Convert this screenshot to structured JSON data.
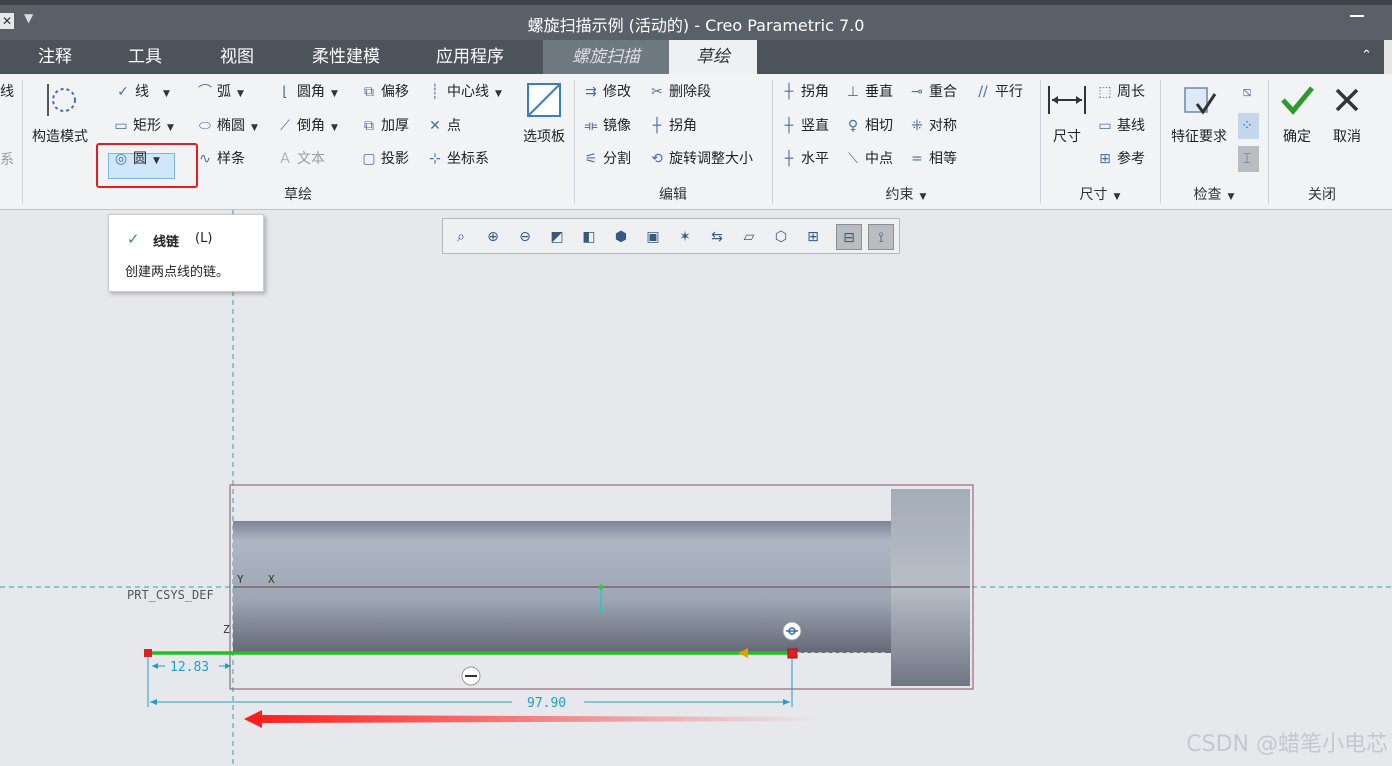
{
  "window": {
    "title": "螺旋扫描示例 (活动的) - Creo Parametric 7.0",
    "qa_icon": "close-x-icon"
  },
  "tabs": [
    {
      "label": "注释"
    },
    {
      "label": "工具"
    },
    {
      "label": "视图"
    },
    {
      "label": "柔性建模"
    },
    {
      "label": "应用程序"
    },
    {
      "label": "螺旋扫描"
    },
    {
      "label": "草绘"
    }
  ],
  "ribbon": {
    "left_cut": {
      "line1": "线",
      "line2": "系"
    },
    "sketch": {
      "construction_mode": "构造模式",
      "line": "线",
      "arc": "弧",
      "rect": "矩形",
      "ellipse": "椭圆",
      "circle": "圆",
      "spline": "样条",
      "fillet": "圆角",
      "chamfer": "倒角",
      "text": "文本",
      "offset": "偏移",
      "thicken": "加厚",
      "project": "投影",
      "centerline": "中心线",
      "point": "点",
      "csys": "坐标系",
      "palette": "选项板",
      "group": "草绘"
    },
    "edit": {
      "modify": "修改",
      "delete_segment": "删除段",
      "mirror": "镜像",
      "corner": "拐角",
      "divide": "分割",
      "rotate_resize": "旋转调整大小",
      "group": "编辑"
    },
    "constrain": {
      "corner": "拐角",
      "perpendicular": "垂直",
      "coincident": "重合",
      "parallel": "平行",
      "vertical": "竖直",
      "tangent": "相切",
      "symmetric": "对称",
      "horizontal": "水平",
      "midpoint": "中点",
      "equal": "相等",
      "group": "约束"
    },
    "dimension": {
      "dimension": "尺寸",
      "perimeter": "周长",
      "baseline": "基线",
      "reference": "参考",
      "group": "尺寸"
    },
    "inspect": {
      "feature_req": "特征要求",
      "group": "检查"
    },
    "close": {
      "ok": "确定",
      "cancel": "取消",
      "group": "关闭"
    }
  },
  "tooltip": {
    "title": "线链",
    "shortcut": "(L)",
    "desc": "创建两点线的链。"
  },
  "canvas": {
    "csys_label": "PRT_CSYS_DEF",
    "axis_y": "Y",
    "axis_x": "X",
    "axis_z": "Z",
    "dim1": "12.83",
    "dim2": "97.90",
    "watermark": "CSDN @蜡笔小电芯"
  },
  "colors": {
    "accent": "#2c9a2c",
    "annotation": "#e02020",
    "dimension": "#20a0c8"
  }
}
